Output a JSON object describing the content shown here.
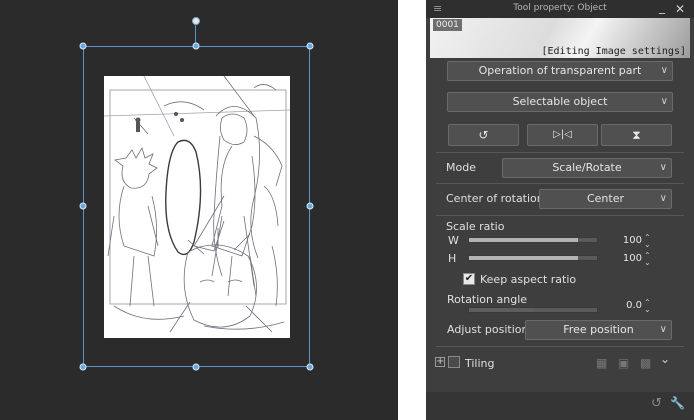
{
  "panel": {
    "title": "Tool property: Object",
    "menu_icon": "≡",
    "minimize_icon": "_",
    "close_icon": "✕"
  },
  "preview": {
    "id": "0001",
    "caption": "[Editing Image settings]"
  },
  "dropdowns": {
    "transparent": "Operation of transparent part",
    "selectable": "Selectable object",
    "mode": "Scale/Rotate",
    "center": "Center",
    "adjust": "Free position"
  },
  "buttons": {
    "reset_icon": "↺",
    "flip_h_icon": "▷|◁",
    "flip_v_icon": "⧗"
  },
  "labels": {
    "mode": "Mode",
    "center": "Center of rotation",
    "scale_ratio": "Scale ratio",
    "w": "W",
    "h": "H",
    "keep_aspect": "Keep aspect ratio",
    "rotation_angle": "Rotation angle",
    "adjust": "Adjust position",
    "tiling": "Tiling"
  },
  "values": {
    "w": "100",
    "h": "100",
    "rotation": "0.0",
    "w_fraction": 0.85,
    "h_fraction": 0.85,
    "rotation_fraction": 0.5
  },
  "checkbox": {
    "keep_aspect_checked": true,
    "keep_aspect_mark": "✔"
  },
  "tiling_icons": {
    "expand": "+",
    "chevron": "⌄"
  },
  "bottom_icons": {
    "reset": "↺",
    "wrench": "🔧"
  },
  "colors": {
    "accent": "#5b93c4",
    "panel_bg": "#3e3e3e",
    "canvas_bg": "#2b2b2b"
  }
}
